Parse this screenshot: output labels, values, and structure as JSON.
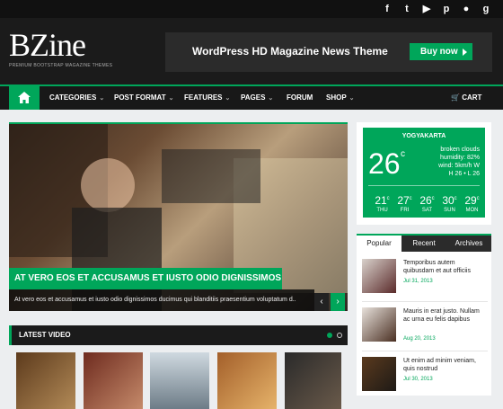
{
  "social_icons": [
    "facebook-icon",
    "twitter-icon",
    "youtube-icon",
    "pinterest-icon",
    "flickr-icon",
    "google-plus-icon"
  ],
  "brand": {
    "logo": "BZine",
    "tagline": "PREMIUM BOOTSTRAP MAGAZINE THEMES"
  },
  "banner": {
    "text": "WordPress HD Magazine News Theme",
    "button": "Buy now"
  },
  "nav": {
    "items": [
      {
        "label": "CATEGORIES",
        "dropdown": true
      },
      {
        "label": "POST FORMAT",
        "dropdown": true
      },
      {
        "label": "FEATURES",
        "dropdown": true
      },
      {
        "label": "PAGES",
        "dropdown": true
      },
      {
        "label": "FORUM",
        "dropdown": false
      },
      {
        "label": "SHOP",
        "dropdown": true
      }
    ],
    "cart": "CART"
  },
  "hero": {
    "title": "AT VERO EOS ET ACCUSAMUS ET IUSTO ODIO DIGNISSIMOS",
    "excerpt": "At vero eos et accusamus et iusto odio dignissimos ducimus qui blanditiis praesentium voluptatum d.."
  },
  "video": {
    "heading": "LATEST VIDEO"
  },
  "weather": {
    "city": "YOGYAKARTA",
    "temp": "26",
    "unit": "c",
    "condition": "broken clouds",
    "humidity": "humidity: 82%",
    "wind": "wind: 5km/h W",
    "hilo": "H 26 • L 26",
    "forecast": [
      {
        "t": "21",
        "d": "THU"
      },
      {
        "t": "27",
        "d": "FRI"
      },
      {
        "t": "26",
        "d": "SAT"
      },
      {
        "t": "30",
        "d": "SUN"
      },
      {
        "t": "29",
        "d": "MON"
      }
    ]
  },
  "tabs": [
    "Popular",
    "Recent",
    "Archives"
  ],
  "posts": [
    {
      "title": "Temporibus autem quibusdam et aut officiis",
      "date": "Jul 31, 2013"
    },
    {
      "title": "Mauris in erat justo. Nullam ac urna eu felis dapibus",
      "date": "Aug 20, 2013"
    },
    {
      "title": "Ut enim ad minim veniam, quis nostrud",
      "date": "Jul 30, 2013"
    }
  ],
  "colors": {
    "accent": "#00a65a",
    "dark": "#1b1b1b"
  }
}
